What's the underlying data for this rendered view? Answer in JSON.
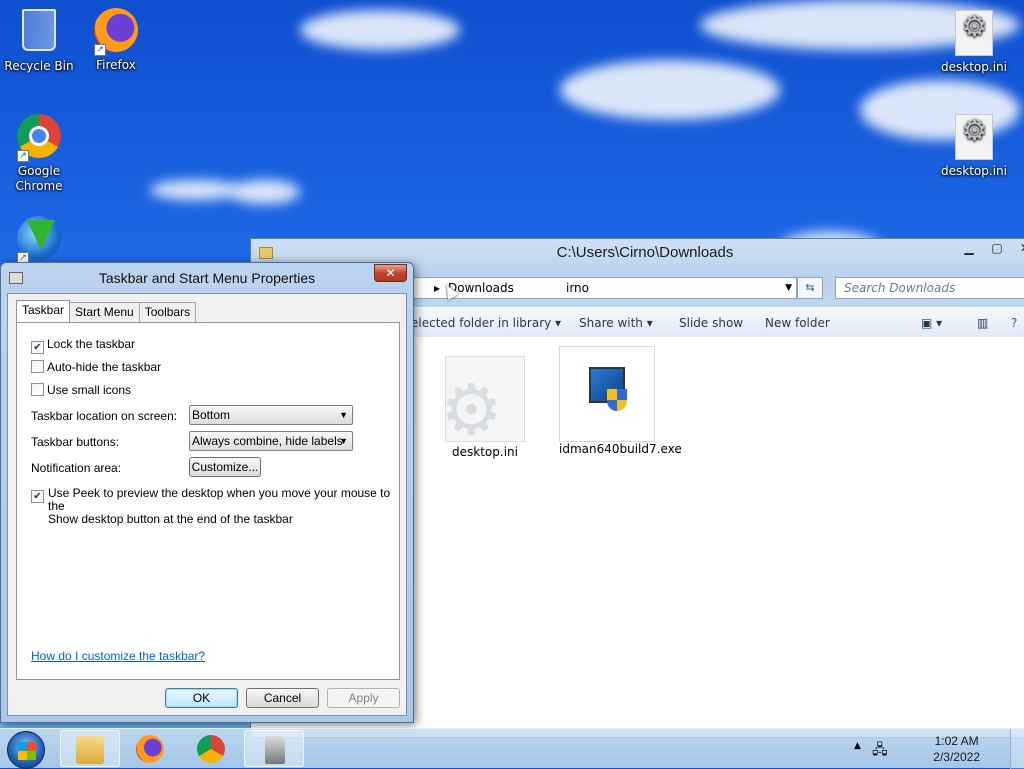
{
  "desktop": {
    "icons": [
      {
        "label": "Recycle Bin",
        "icon": "recycle-bin-icon"
      },
      {
        "label": "Firefox",
        "icon": "firefox-icon"
      },
      {
        "label": "Google Chrome",
        "icon": "chrome-icon"
      },
      {
        "label": "desktop.ini",
        "icon": "settings-file-icon"
      },
      {
        "label": "desktop.ini",
        "icon": "settings-file-icon"
      }
    ]
  },
  "explorer": {
    "title": "C:\\Users\\Cirno\\Downloads",
    "address_prev": "irno",
    "address_current": "Downloads",
    "search_placeholder": "Search Downloads",
    "commands": {
      "include": "elected folder in library ▾",
      "share": "Share with ▾",
      "slideshow": "Slide show",
      "newfolder": "New folder"
    },
    "files": [
      {
        "name": "desktop.ini"
      },
      {
        "name": "idman640build7.exe"
      }
    ]
  },
  "dialog": {
    "title": "Taskbar and Start Menu Properties",
    "tabs": [
      "Taskbar",
      "Start Menu",
      "Toolbars"
    ],
    "active_tab": "Taskbar",
    "lock_taskbar": {
      "label": "Lock the taskbar",
      "checked": true
    },
    "auto_hide": {
      "label": "Auto-hide the taskbar",
      "checked": false
    },
    "small_icons": {
      "label": "Use small icons",
      "checked": false
    },
    "location_label": "Taskbar location on screen:",
    "location_value": "Bottom",
    "buttons_label": "Taskbar buttons:",
    "buttons_value": "Always combine, hide labels",
    "notification_label": "Notification area:",
    "customize_button": "Customize...",
    "peek": {
      "label_line1": "Use Peek to preview the desktop when you move your mouse to the",
      "label_line2": "Show desktop button at the end of the taskbar",
      "checked": true
    },
    "help_link": "How do I customize the taskbar?",
    "ok": "OK",
    "cancel": "Cancel",
    "apply": "Apply"
  },
  "taskbar": {
    "time": "1:02 AM",
    "date": "2/3/2022"
  },
  "colors": {
    "desktop_blue": "#1d66e3",
    "dialog_frame": "#bcd3ee",
    "link": "#0066cc",
    "close_red": "#c7432a"
  }
}
